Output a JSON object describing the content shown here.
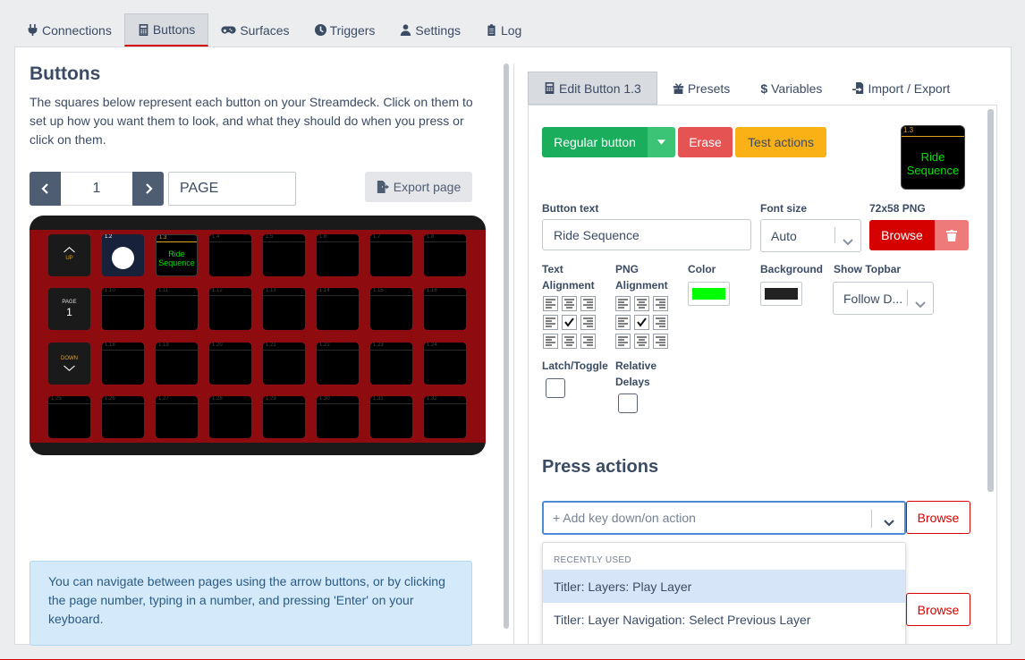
{
  "top_tabs": [
    {
      "label": "Connections",
      "icon": "plug-icon"
    },
    {
      "label": "Buttons",
      "icon": "calculator-icon",
      "active": true
    },
    {
      "label": "Surfaces",
      "icon": "gamepad-icon"
    },
    {
      "label": "Triggers",
      "icon": "clock-icon"
    },
    {
      "label": "Settings",
      "icon": "user-cog-icon"
    },
    {
      "label": "Log",
      "icon": "clipboard-icon"
    }
  ],
  "buttons_panel": {
    "title": "Buttons",
    "description": "The squares below represent each button on your Streamdeck. Click on them to set up how you want them to look, and what they should do when you press or click on them.",
    "page_number": "1",
    "page_name": "PAGE",
    "export_label": "Export page",
    "info": "You can navigate between pages using the arrow buttons, or by clicking the page number, typing in a number, and pressing 'Enter' on your keyboard."
  },
  "grid": {
    "up_label": "UP",
    "page_label": "PAGE",
    "page_value": "1",
    "down_label": "DOWN",
    "key_1_2": "1.2",
    "key_1_3": "1.3",
    "key_1_3_text": "Ride Sequence",
    "key_numbers": [
      "1.4",
      "1.5",
      "1.6",
      "1.7",
      "1.8",
      "1.10",
      "1.11",
      "1.12",
      "1.13",
      "1.14",
      "1.15",
      "1.16",
      "1.18",
      "1.19",
      "1.20",
      "1.21",
      "1.22",
      "1.23",
      "1.24",
      "1.25",
      "1.26",
      "1.27",
      "1.28",
      "1.29",
      "1.30",
      "1.31",
      "1.32"
    ],
    "deck_color": "#8e0c10"
  },
  "editor": {
    "tabs": [
      {
        "label": "Edit Button 1.3",
        "icon": "calculator-icon",
        "active": true
      },
      {
        "label": "Presets",
        "icon": "gift-icon"
      },
      {
        "label": "Variables",
        "icon": "dollar-icon"
      },
      {
        "label": "Import / Export",
        "icon": "file-import-icon"
      }
    ],
    "regular_button": "Regular button",
    "erase": "Erase",
    "test_actions": "Test actions",
    "preview_number": "1.3",
    "preview_text": "Ride Sequence",
    "button_text_label": "Button text",
    "button_text_value": "Ride Sequence",
    "font_size_label": "Font size",
    "font_size_value": "Auto",
    "png_label": "72x58 PNG",
    "browse": "Browse",
    "text_alignment_label": "Text Alignment",
    "png_alignment_label": "PNG Alignment",
    "color_label": "Color",
    "color_value": "#00ff00",
    "background_label": "Background",
    "background_value": "#222222",
    "show_topbar_label": "Show Topbar",
    "show_topbar_value": "Follow D...",
    "latch_label": "Latch/Toggle",
    "relative_delays_label": "Relative Delays",
    "press_actions_title": "Press actions",
    "action_placeholder": "+ Add key down/on action",
    "recently_used": "RECENTLY USED",
    "menu_items": [
      "Titler: Layers: Play Layer",
      "Titler: Layer Navigation: Select Previous Layer"
    ]
  }
}
